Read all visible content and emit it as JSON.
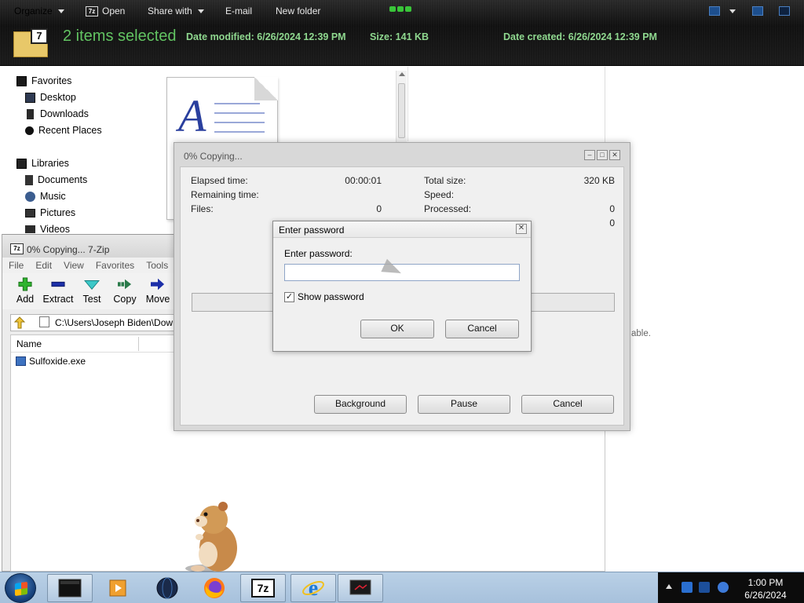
{
  "explorer": {
    "toolbar": {
      "organize": "Organize",
      "open": "Open",
      "open_badge": "7z",
      "share_with": "Share with",
      "email": "E-mail",
      "new_folder": "New folder"
    },
    "details": {
      "selection": "2 items selected",
      "date_modified_label": "Date modified:",
      "date_modified": "6/26/2024 12:39 PM",
      "size_label": "Size:",
      "size": "141 KB",
      "date_created_label": "Date created:",
      "date_created": "6/26/2024 12:39 PM"
    },
    "nav": {
      "favorites": "Favorites",
      "desktop": "Desktop",
      "downloads": "Downloads",
      "recent_places": "Recent Places",
      "libraries": "Libraries",
      "documents": "Documents",
      "music": "Music",
      "pictures": "Pictures",
      "videos": "Videos"
    },
    "preview_fragment": "able."
  },
  "sevenzip": {
    "title": "0% Copying... 7-Zip",
    "title_badge": "7z",
    "menu": [
      "File",
      "Edit",
      "View",
      "Favorites",
      "Tools"
    ],
    "tools": {
      "add": "Add",
      "extract": "Extract",
      "test": "Test",
      "copy": "Copy",
      "move": "Move"
    },
    "address": "C:\\Users\\Joseph Biden\\Down",
    "column_name": "Name",
    "files": [
      "Sulfoxide.exe"
    ]
  },
  "copying": {
    "title": "0% Copying...",
    "elapsed_label": "Elapsed time:",
    "elapsed": "00:00:01",
    "remaining_label": "Remaining time:",
    "files_label": "Files:",
    "files": "0",
    "total_size_label": "Total size:",
    "total_size": "320 KB",
    "speed_label": "Speed:",
    "processed_label": "Processed:",
    "processed": "0",
    "partial_value": "0",
    "progress": 0,
    "background_btn": "Background",
    "pause_btn": "Pause",
    "cancel_btn": "Cancel"
  },
  "password": {
    "title": "Enter password",
    "label": "Enter password:",
    "value": "",
    "show_password": "Show password",
    "show_checked": true,
    "ok": "OK",
    "cancel": "Cancel"
  },
  "taskbar": {
    "apps": [
      "terminal-icon",
      "media-player-icon",
      "globe-icon",
      "firefox-icon",
      "7zip-icon",
      "internet-explorer-icon",
      "monitor-icon"
    ],
    "sevenzip_badge": "7z",
    "time": "1:00 PM",
    "date": "6/26/2024"
  },
  "colors": {
    "accent_green": "#62c462",
    "meta_green": "#8fd88f",
    "taskbar": "#a7c1dc"
  }
}
